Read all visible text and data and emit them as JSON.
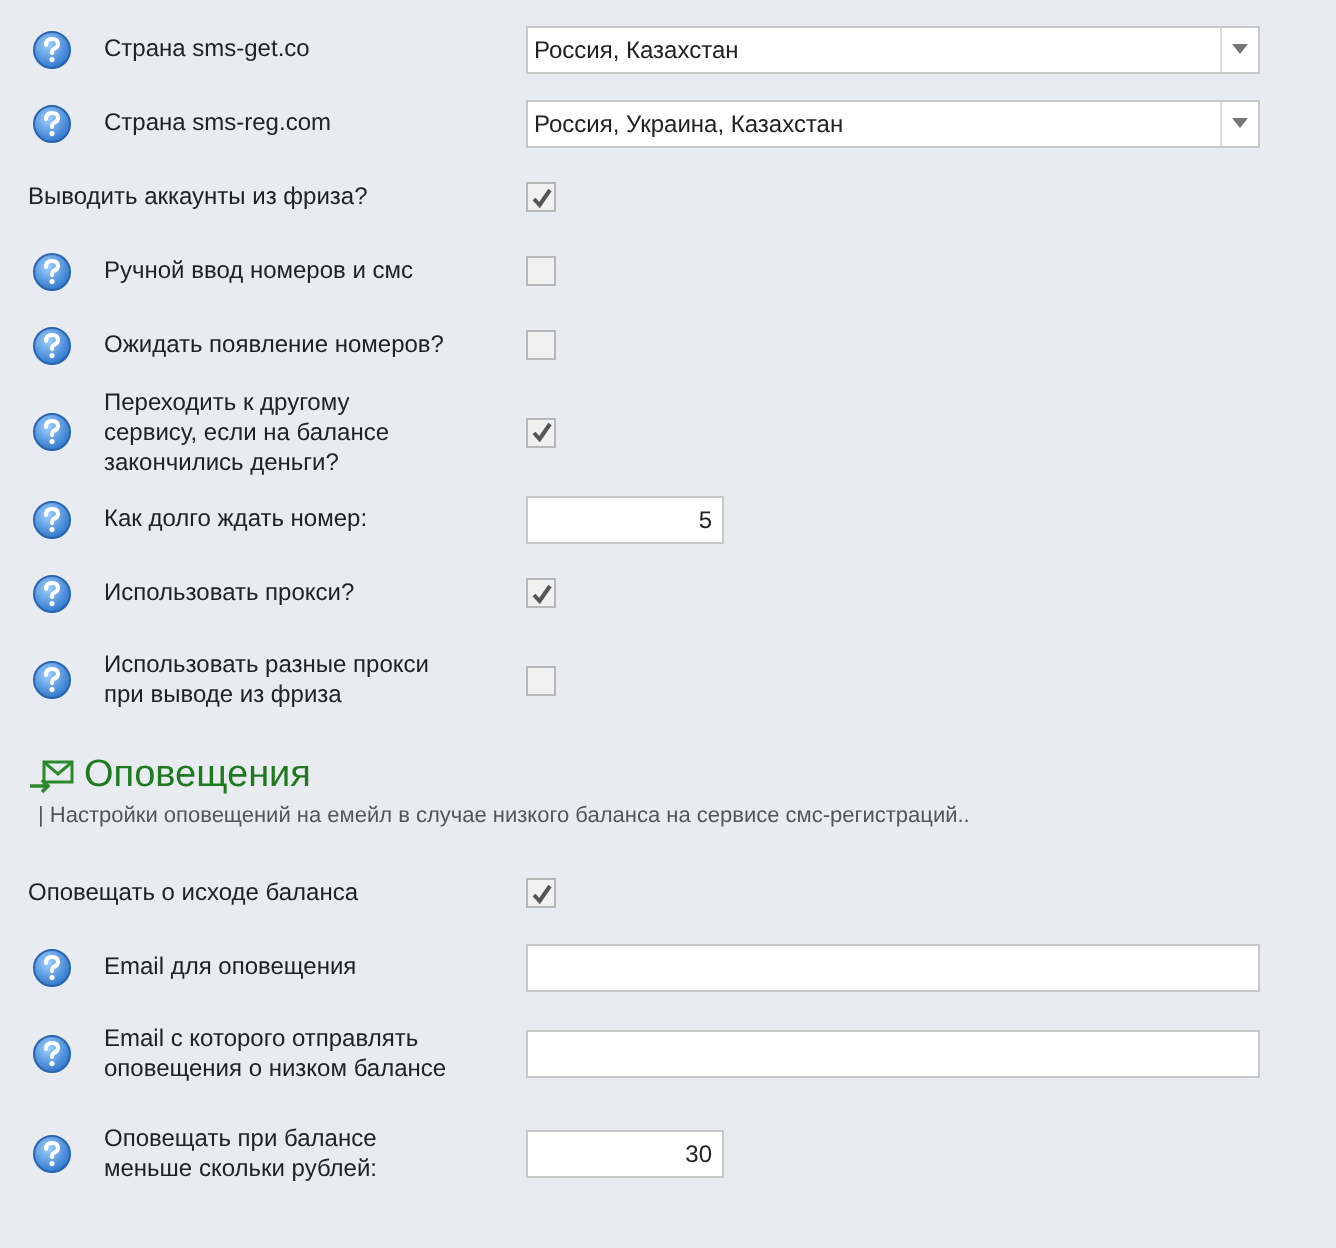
{
  "settings": [
    {
      "kind": "select",
      "help": true,
      "label": "Страна sms-get.co",
      "value": "Россия, Казахстан"
    },
    {
      "kind": "select",
      "help": true,
      "label": "Страна sms-reg.com",
      "value": "Россия, Украина, Казахстан"
    },
    {
      "kind": "checkbox",
      "help": false,
      "label": "Выводить аккаунты из фриза?",
      "checked": true
    },
    {
      "kind": "checkbox",
      "help": true,
      "label": "Ручной ввод номеров и смс",
      "checked": false
    },
    {
      "kind": "checkbox",
      "help": true,
      "label": "Ожидать появление номеров?",
      "checked": false
    },
    {
      "kind": "checkbox",
      "help": true,
      "label": "Переходить к другому сервису, если на балансе закончились деньги?",
      "checked": true
    },
    {
      "kind": "number",
      "help": true,
      "label": "Как долго ждать номер:",
      "value": "5"
    },
    {
      "kind": "checkbox",
      "help": true,
      "label": "Использовать прокси?",
      "checked": true
    },
    {
      "kind": "checkbox",
      "help": true,
      "label": "Использовать разные прокси при выводе из фриза",
      "checked": false
    }
  ],
  "notifications": {
    "title": "Оповещения",
    "description": "| Настройки оповещений на емейл в случае низкого баланса на сервисе смс-регистраций..",
    "settings": [
      {
        "kind": "checkbox",
        "help": false,
        "label": "Оповещать о исходе баланса",
        "checked": true
      },
      {
        "kind": "text",
        "help": true,
        "label": "Email для оповещения"
      },
      {
        "kind": "text",
        "help": true,
        "label": "Email с которого отправлять оповещения о низком балансе"
      },
      {
        "kind": "number",
        "help": true,
        "label": "Оповещать при балансе меньше скольки рублей:",
        "value": "30"
      }
    ]
  }
}
